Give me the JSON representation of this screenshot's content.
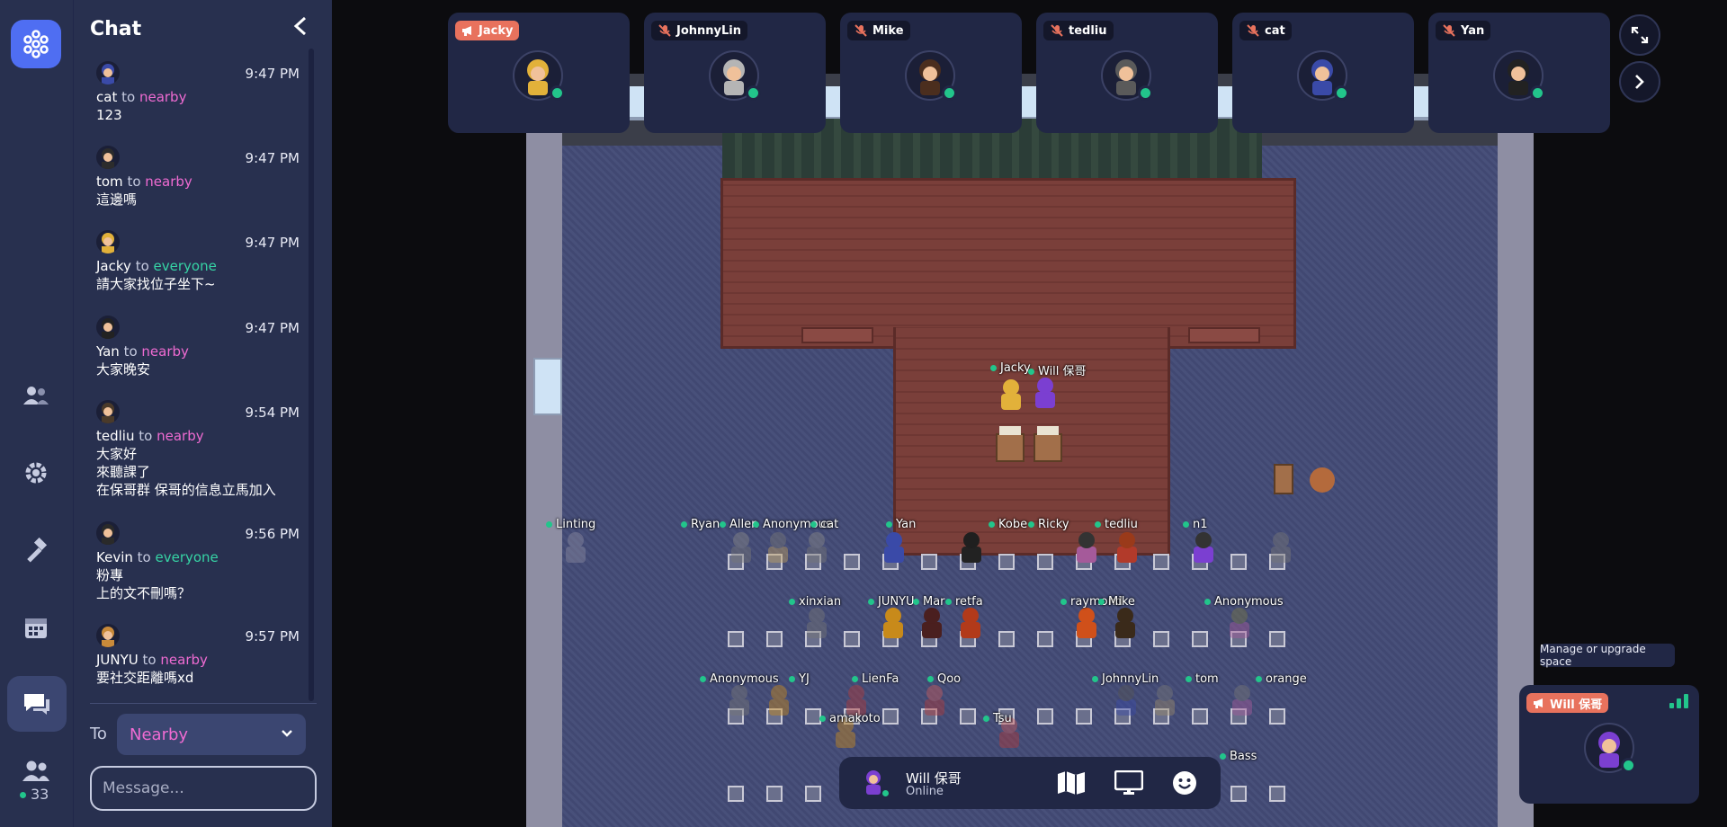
{
  "nav": {
    "online_count": "33",
    "icons": [
      "logo-icon",
      "people-icon",
      "settings-icon",
      "build-icon",
      "calendar-icon",
      "chat-icon",
      "participants-icon"
    ]
  },
  "chat": {
    "title": "Chat",
    "messages": [
      {
        "sender": "cat",
        "to_word": "to",
        "audience": "nearby",
        "time": "9:47 PM",
        "lines": [
          "123"
        ]
      },
      {
        "sender": "tom",
        "to_word": "to",
        "audience": "nearby",
        "time": "9:47 PM",
        "lines": [
          "這邊嗎"
        ]
      },
      {
        "sender": "Jacky",
        "to_word": "to",
        "audience": "everyone",
        "time": "9:47 PM",
        "lines": [
          "請大家找位子坐下~"
        ]
      },
      {
        "sender": "Yan",
        "to_word": "to",
        "audience": "nearby",
        "time": "9:47 PM",
        "lines": [
          "大家晚安"
        ]
      },
      {
        "sender": "tedliu",
        "to_word": "to",
        "audience": "nearby",
        "time": "9:54 PM",
        "lines": [
          "大家好",
          "來聽課了",
          "在保哥群 保哥的信息立馬加入"
        ]
      },
      {
        "sender": "Kevin",
        "to_word": "to",
        "audience": "everyone",
        "time": "9:56 PM",
        "lines": [
          "粉專",
          "上的文不刪嗎？"
        ]
      },
      {
        "sender": "JUNYU",
        "to_word": "to",
        "audience": "nearby",
        "time": "9:57 PM",
        "lines": [
          "要社交距離嗎xd"
        ]
      }
    ],
    "to_label": "To",
    "to_value": "Nearby",
    "message_placeholder": "Message..."
  },
  "video_tiles": [
    {
      "name": "Jacky",
      "live": true
    },
    {
      "name": "JohnnyLin",
      "live": false
    },
    {
      "name": "Mike",
      "live": false
    },
    {
      "name": "tedliu",
      "live": false
    },
    {
      "name": "cat",
      "live": false
    },
    {
      "name": "Yan",
      "live": false
    }
  ],
  "map_names": {
    "stage": [
      "Jacky",
      "Will 保哥"
    ],
    "row1": [
      "Linting",
      "Ryan",
      "Allen",
      "Anonymous",
      "cat",
      "Yan",
      "Kobe",
      "Ricky",
      "tedliu",
      "n1"
    ],
    "row2": [
      "xinxian",
      "JUNYU",
      "Mar",
      "retfa",
      "raymond",
      "Mike",
      "Anonymous"
    ],
    "row3": [
      "Anonymous",
      "YJ",
      "LienFa",
      "Qoo",
      "JohnnyLin",
      "tom",
      "orange"
    ],
    "row4": [
      "amakoto",
      "Tsu",
      "Bass"
    ]
  },
  "bottom_bar": {
    "name": "Will 保哥",
    "status": "Online"
  },
  "self_tile": {
    "name": "Will 保哥",
    "manage_label": "Manage or upgrade space"
  },
  "colors": {
    "nearby": "#ef6bd2",
    "everyone": "#36d4a5",
    "online": "#22c58b",
    "accent": "#4f6ef2",
    "live_tag": "#e8725d"
  }
}
